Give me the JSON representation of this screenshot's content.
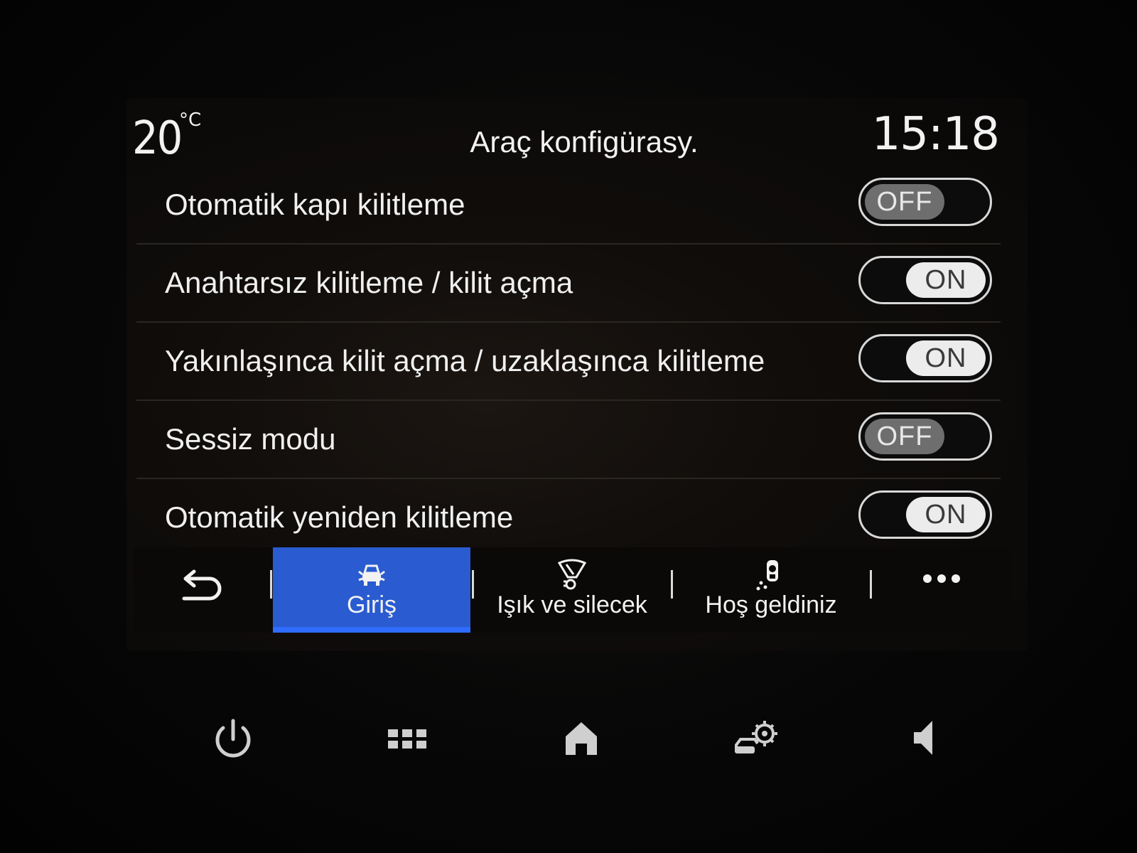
{
  "status_bar": {
    "temperature": "20",
    "temperature_unit": "°C",
    "title": "Araç konfigürasy.",
    "clock": "15:18"
  },
  "settings": [
    {
      "label": "Otomatik kapı kilitleme",
      "state": "OFF"
    },
    {
      "label": "Anahtarsız kilitleme / kilit açma",
      "state": "ON"
    },
    {
      "label": "Yakınlaşınca kilit açma / uzaklaşınca kilitleme",
      "state": "ON"
    },
    {
      "label": "Sessiz modu",
      "state": "OFF"
    },
    {
      "label": "Otomatik yeniden kilitleme",
      "state": "ON"
    }
  ],
  "tabbar": {
    "back_icon": "back-arrow-icon",
    "tabs": [
      {
        "label": "Giriş",
        "icon": "car-doors-icon",
        "active": true
      },
      {
        "label": "Işık ve silecek",
        "icon": "light-wiper-icon",
        "active": false
      },
      {
        "label": "Hoş geldiniz",
        "icon": "welcome-person-icon",
        "active": false
      }
    ],
    "more_icon": "more-dots-icon"
  },
  "dock": {
    "items": [
      "power-icon",
      "apps-grid-icon",
      "home-icon",
      "car-settings-icon",
      "volume-icon"
    ]
  },
  "colors": {
    "accent": "#2a5bd0",
    "accent_underline": "#2f6cff",
    "text": "#f2f2f2",
    "toggle_on_knob": "#ececec",
    "toggle_off_knob": "#6e6e6e"
  }
}
